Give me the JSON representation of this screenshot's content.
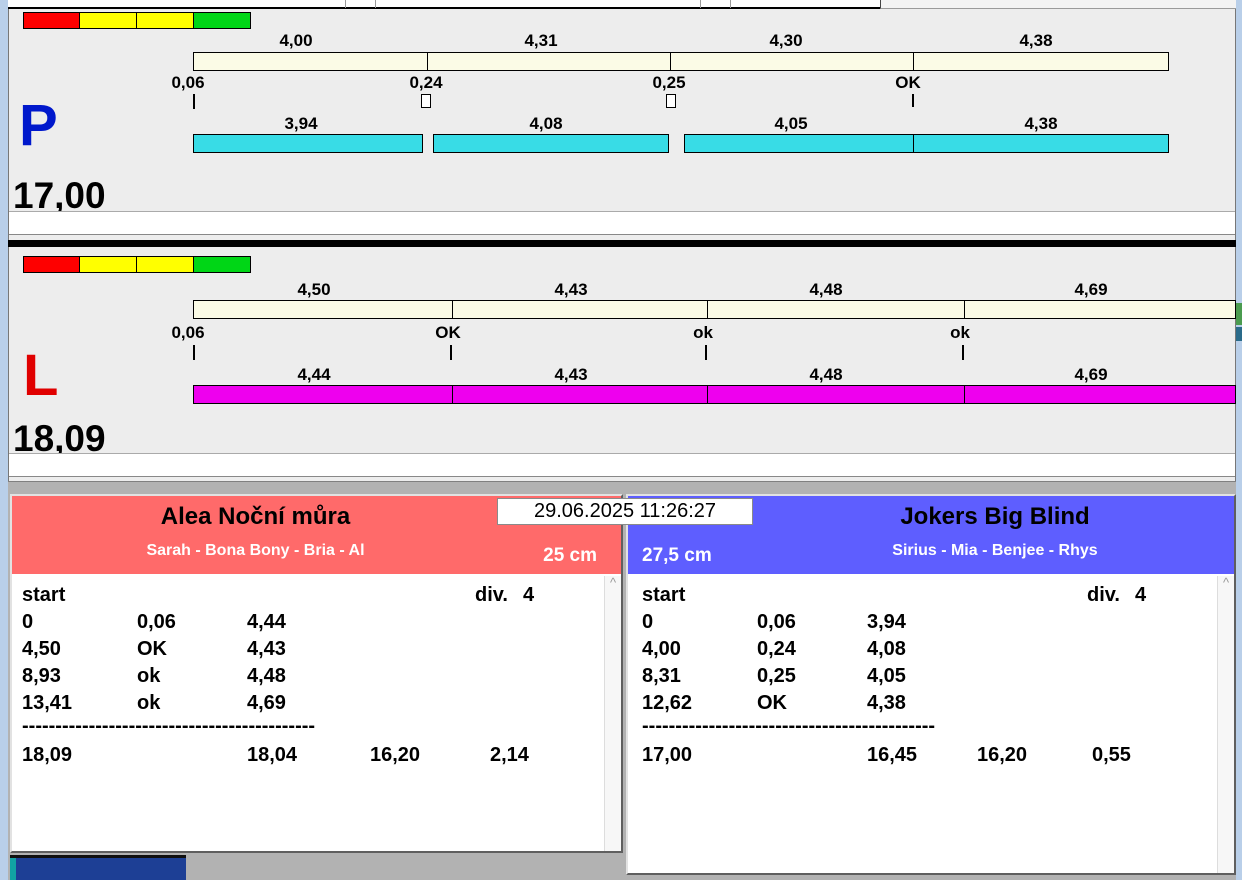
{
  "header": {
    "timestamp": "29.06.2025 11:26:27"
  },
  "colors": {
    "lane_p_bar": "#38dce6",
    "lane_l_bar": "#ee00ee",
    "lane_p_letter": "#0018cc",
    "lane_l_letter": "#e00000",
    "team_left_header": "#ff6a6a",
    "team_right_header": "#5e5eff",
    "cream_bar": "#fbfbe6",
    "light_red": "#fe0000",
    "light_yellow": "#ffff00",
    "light_green": "#00d616"
  },
  "lanes": [
    {
      "letter": "P",
      "total": "17,00",
      "segment_times": [
        "4,00",
        "4,31",
        "4,30",
        "4,38"
      ],
      "pass_marks": [
        "0,06",
        "0,24",
        "0,25",
        "OK"
      ],
      "dog_times": [
        "3,94",
        "4,08",
        "4,05",
        "4,38"
      ]
    },
    {
      "letter": "L",
      "total": "18,09",
      "segment_times": [
        "4,50",
        "4,43",
        "4,48",
        "4,69"
      ],
      "pass_marks": [
        "0,06",
        "OK",
        "ok",
        "ok"
      ],
      "dog_times": [
        "4,44",
        "4,43",
        "4,48",
        "4,69"
      ]
    }
  ],
  "teams": [
    {
      "name": "Alea Noční můra",
      "members": "Sarah - Bona Bony - Bria - Al",
      "jump_height": "25 cm",
      "start_label": "start",
      "div_label": "div.",
      "div_value": "4",
      "rows": [
        [
          "0",
          "0,06",
          "4,44"
        ],
        [
          "4,50",
          "OK",
          "4,43"
        ],
        [
          "8,93",
          "ok",
          "4,48"
        ],
        [
          "13,41",
          "ok",
          "4,69"
        ]
      ],
      "separator": "--------------------------------------------",
      "totals": [
        "18,09",
        "18,04",
        "16,20",
        "2,14"
      ],
      "scroll_up": "^"
    },
    {
      "name": "Jokers Big Blind",
      "members": "Sirius - Mia - Benjee - Rhys",
      "jump_height": "27,5 cm",
      "start_label": "start",
      "div_label": "div.",
      "div_value": "4",
      "rows": [
        [
          "0",
          "0,06",
          "3,94"
        ],
        [
          "4,00",
          "0,24",
          "4,08"
        ],
        [
          "8,31",
          "0,25",
          "4,05"
        ],
        [
          "12,62",
          "OK",
          "4,38"
        ]
      ],
      "separator": "--------------------------------------------",
      "totals": [
        "17,00",
        "16,45",
        "16,20",
        "0,55"
      ],
      "scroll_up": "^"
    }
  ]
}
